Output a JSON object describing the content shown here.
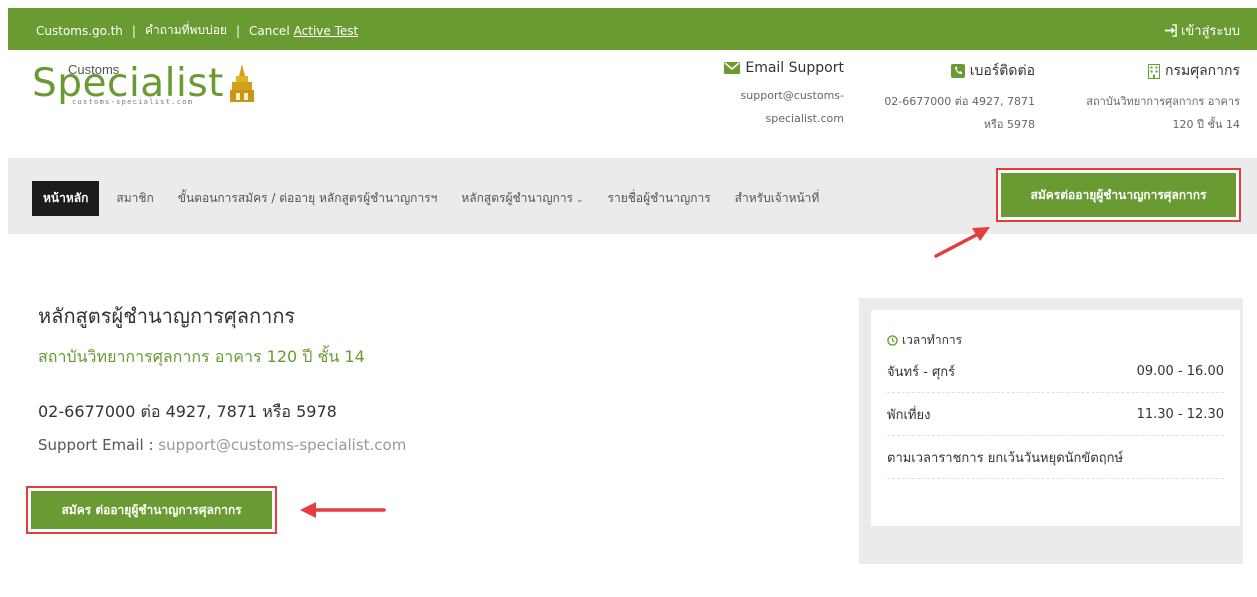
{
  "topbar": {
    "link_customs": "Customs.go.th",
    "link_faq": "คำถามที่พบบ่อย",
    "cancel_text": "Cancel",
    "active_test": "Active Test",
    "login": "เข้าสู่ระบบ"
  },
  "logo": {
    "brand": "Specialist",
    "customs": "Customs",
    "domain": "customs-specialist.com"
  },
  "contacts": {
    "email": {
      "label": "Email Support",
      "line1": "support@customs-",
      "line2": "specialist.com"
    },
    "phone": {
      "label": "เบอร์ติดต่อ",
      "line1": "02-6677000 ต่อ 4927, 7871",
      "line2": "หรือ 5978"
    },
    "dept": {
      "label": "กรมศุลกากร",
      "line1": "สถาบันวิทยาการศุลกากร อาคาร",
      "line2": "120 ปี ชั้น 14"
    }
  },
  "nav": {
    "home": "หน้าหลัก",
    "members": "สมาชิก",
    "steps": "ขั้นตอนการสมัคร / ต่ออายุ หลักสูตรผู้ชำนาญการฯ",
    "courses": "หลักสูตรผู้ชำนาญการ",
    "list": "รายชื่อผู้ชำนาญการ",
    "staff": "สำหรับเจ้าหน้าที่",
    "cta": "สมัครต่ออายุผู้ชำนาญการศุลกากร"
  },
  "main": {
    "title": "หลักสูตรผู้ชำนาญการศุลกากร",
    "subtitle": "สถาบันวิทยาการศุลกากร อาคาร 120 ปี ชั้น 14",
    "phone": "02-6677000 ต่อ 4927, 7871 หรือ 5978",
    "email_label": "Support Email : ",
    "email_value": "support@customs-specialist.com",
    "cta": "สมัคร ต่ออายุผู้ชำนาญการศุลกากร"
  },
  "hours": {
    "title": "เวลาทำการ",
    "rows": [
      {
        "label": "จันทร์ - ศุกร์",
        "value": "09.00 - 16.00"
      },
      {
        "label": "พักเที่ยง",
        "value": "11.30 - 12.30"
      }
    ],
    "note": "ตามเวลาราชการ ยกเว้นวันหยุดนักขัตฤกษ์"
  },
  "colors": {
    "brand_green": "#6a9a32",
    "highlight_red": "#e33d3d",
    "dark": "#1c1c1c"
  }
}
